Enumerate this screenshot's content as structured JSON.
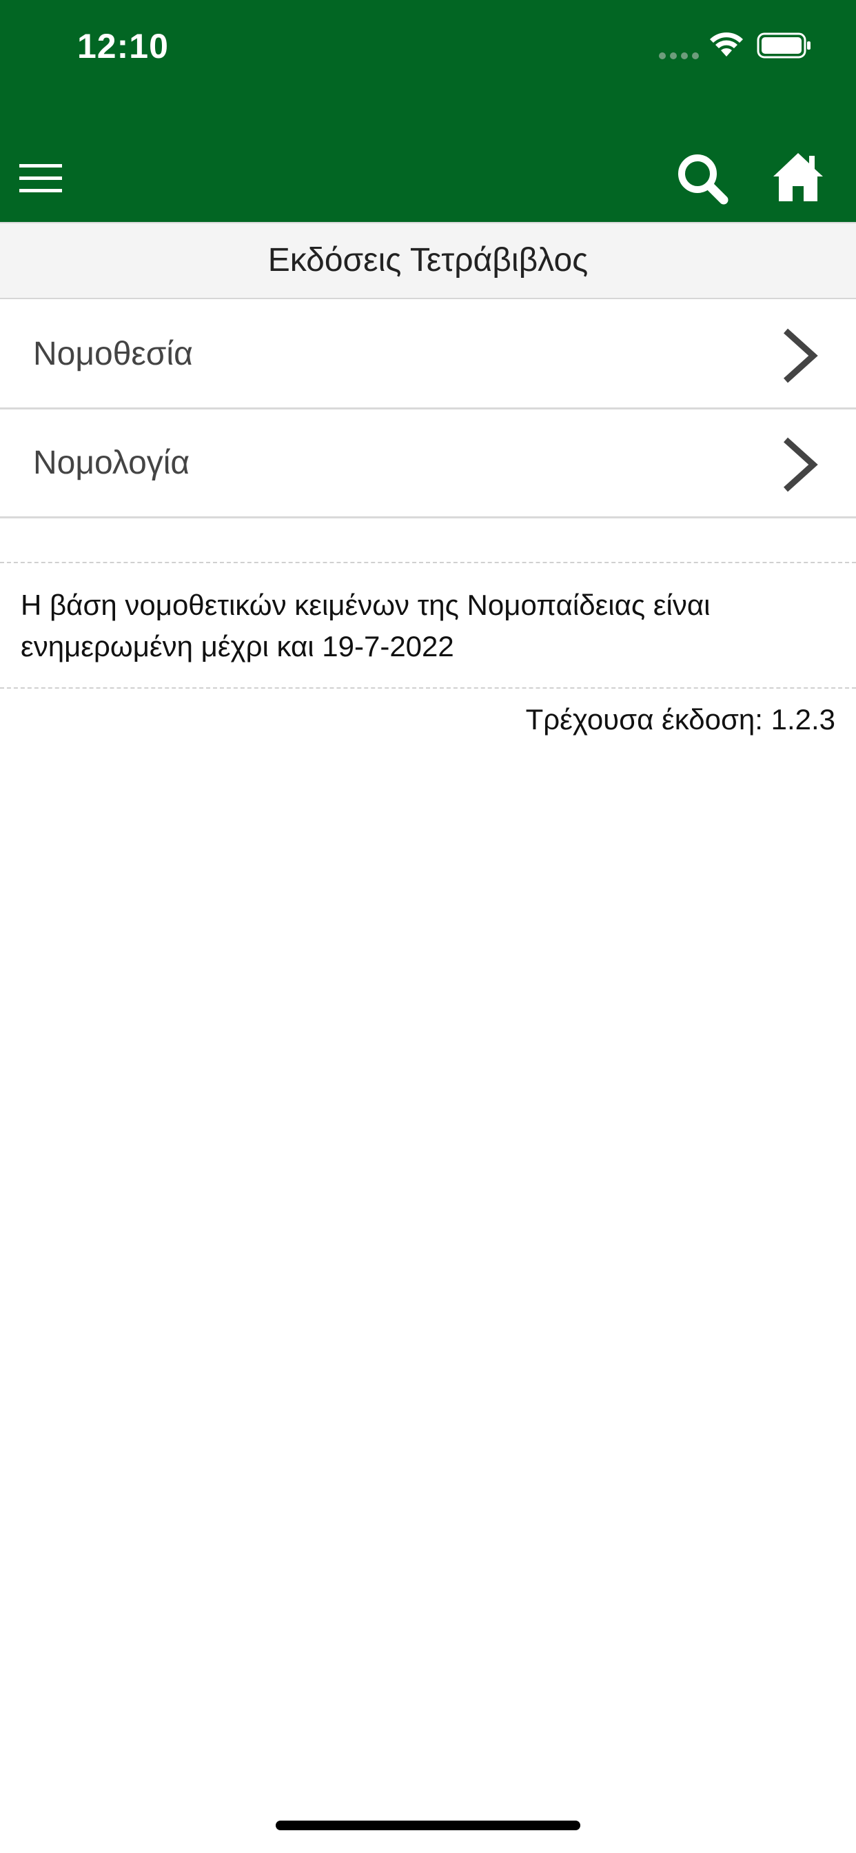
{
  "status_bar": {
    "time": "12:10"
  },
  "nav": {
    "menu_icon": "hamburger-menu-icon",
    "search_icon": "search-icon",
    "home_icon": "home-icon"
  },
  "section": {
    "title": "Εκδόσεις Τετράβιβλος"
  },
  "list": {
    "items": [
      {
        "label": "Νομοθεσία"
      },
      {
        "label": "Νομολογία"
      }
    ]
  },
  "info": {
    "line1": "Η βάση νομοθετικών κειμένων της Νομοπαίδειας είναι",
    "line2": "ενημερωμένη μέχρι και 19-7-2022"
  },
  "version": {
    "text": "Τρέχουσα έκδοση: 1.2.3"
  },
  "colors": {
    "header_green": "#026623",
    "title_bar_bg": "#f4f4f4",
    "divider": "#d9d9d9"
  }
}
